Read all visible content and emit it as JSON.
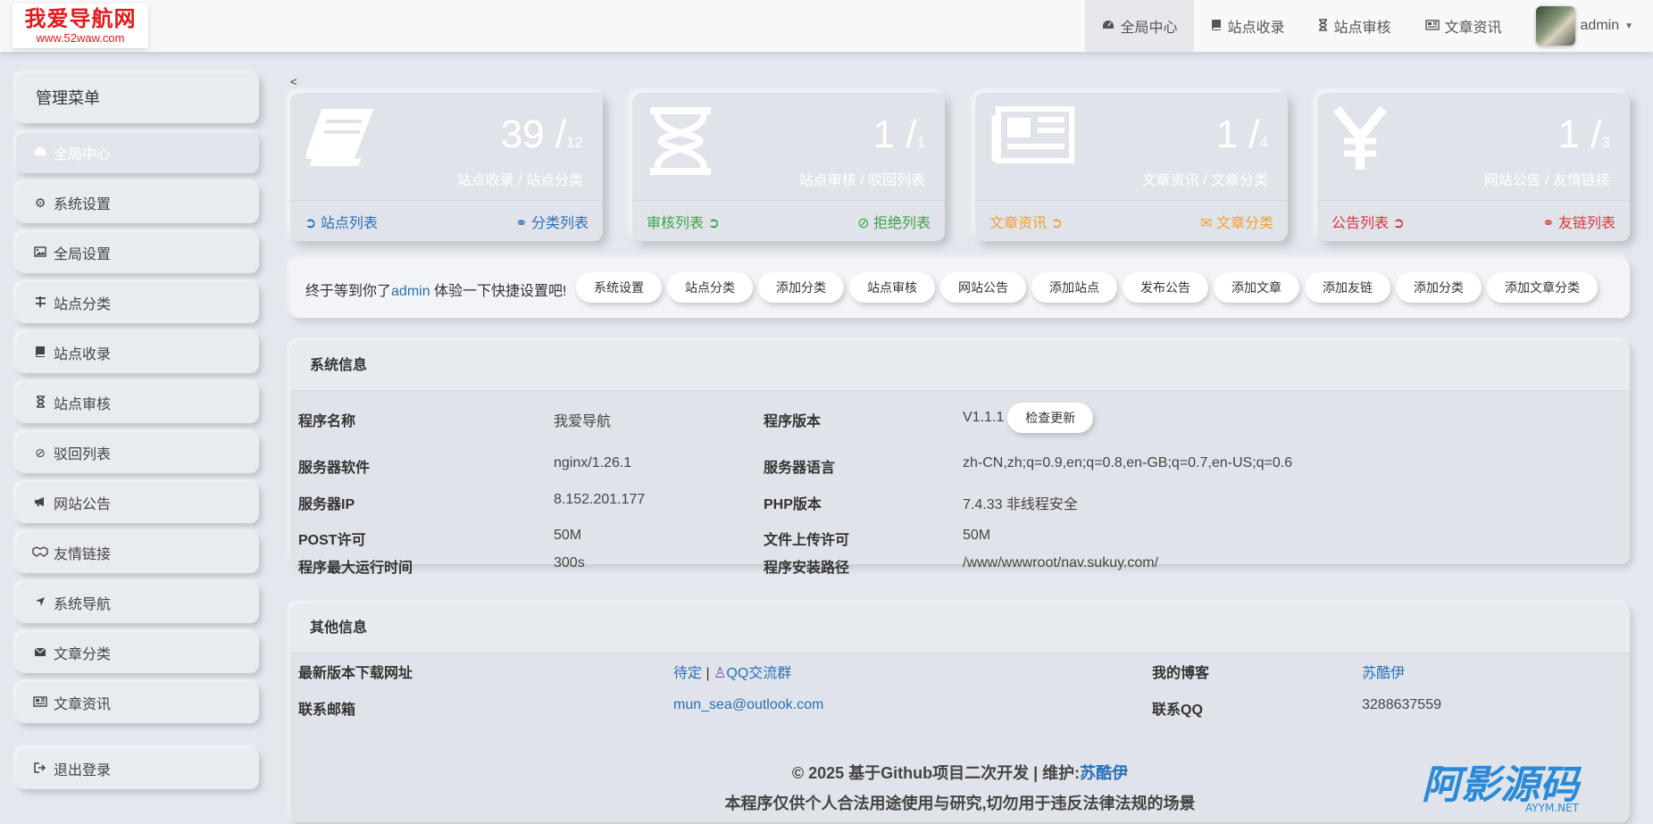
{
  "logo": {
    "title": "我爱导航网",
    "url": "www.52waw.com"
  },
  "topnav": {
    "items": [
      {
        "label": "全局中心",
        "icon": "dashboard-icon"
      },
      {
        "label": "站点收录",
        "icon": "book-icon"
      },
      {
        "label": "站点审核",
        "icon": "hourglass-icon"
      },
      {
        "label": "文章资讯",
        "icon": "newspaper-icon"
      }
    ],
    "user": "admin"
  },
  "sidebar": {
    "title": "管理菜单",
    "items": [
      {
        "label": "全局中心",
        "icon": "dashboard-icon"
      },
      {
        "label": "系统设置",
        "icon": "gear-icon"
      },
      {
        "label": "全局设置",
        "icon": "image-icon"
      },
      {
        "label": "站点分类",
        "icon": "sliders-icon"
      },
      {
        "label": "站点收录",
        "icon": "book-icon"
      },
      {
        "label": "站点审核",
        "icon": "hourglass-icon"
      },
      {
        "label": "驳回列表",
        "icon": "ban-icon"
      },
      {
        "label": "网站公告",
        "icon": "bullhorn-icon"
      },
      {
        "label": "友情链接",
        "icon": "handshake-icon"
      },
      {
        "label": "系统导航",
        "icon": "location-arrow-icon"
      },
      {
        "label": "文章分类",
        "icon": "envelope-icon"
      },
      {
        "label": "文章资讯",
        "icon": "newspaper-icon"
      }
    ],
    "logout": "退出登录"
  },
  "back": "<",
  "cards": [
    {
      "count": "39",
      "sep": " /",
      "sub": "12",
      "caption": "站点收录 / 站点分类",
      "left_link": "站点列表",
      "right_link": "分类列表",
      "color": "#2a6fb7"
    },
    {
      "count": "1",
      "sep": " /",
      "sub": "1",
      "caption": "站点审核 / 驳回列表",
      "left_link": "审核列表",
      "right_link": "拒绝列表",
      "color": "#3aa54a"
    },
    {
      "count": "1",
      "sep": " /",
      "sub": "4",
      "caption": "文章资讯 / 文章分类",
      "left_link": "文章资讯",
      "right_link": "文章分类",
      "color": "#f0a030"
    },
    {
      "count": "1",
      "sep": " /",
      "sub": "3",
      "caption": "网站公告 / 友情链接",
      "left_link": "公告列表",
      "right_link": "友链列表",
      "color": "#d9363a"
    }
  ],
  "quick": {
    "greet_pre": "终于等到你了",
    "user": "admin",
    "greet_post": " 体验一下快捷设置吧!",
    "buttons": [
      "系统设置",
      "站点分类",
      "添加分类",
      "站点审核",
      "网站公告",
      "添加站点",
      "发布公告",
      "添加文章",
      "添加友链",
      "添加分类",
      "添加文章分类"
    ]
  },
  "system": {
    "title": "系统信息",
    "rows": [
      {
        "l1": "程序名称",
        "v1": "我爱导航",
        "l2": "程序版本",
        "v2": "V1.1.1"
      },
      {
        "l1": "服务器软件",
        "v1": "nginx/1.26.1",
        "l2": "服务器语言",
        "v2": "zh-CN,zh;q=0.9,en;q=0.8,en-GB;q=0.7,en-US;q=0.6"
      },
      {
        "l1": "服务器IP",
        "v1": "8.152.201.177",
        "l2": "PHP版本",
        "v2": "7.4.33 非线程安全"
      },
      {
        "l1": "POST许可",
        "v1": "50M",
        "l2": "文件上传许可",
        "v2": "50M"
      },
      {
        "l1": "程序最大运行时间",
        "v1": "300s",
        "l2": "程序安装路径",
        "v2": "/www/wwwroot/nav.sukuy.com/"
      }
    ],
    "check_update": "检查更新"
  },
  "other": {
    "title": "其他信息",
    "download_label": "最新版本下载网址",
    "download_value": "待定",
    "pipe": " | ",
    "qq_group": "QQ交流群",
    "blog_label": "我的博客",
    "blog_value": "苏酷伊",
    "email_label": "联系邮箱",
    "email_value": "mun_sea@outlook.com",
    "qq_label": "联系QQ",
    "qq_value": "3288637559"
  },
  "footer": {
    "line1_pre": "© 2025 基于Github项目二次开发 | 维护:",
    "line1_author": "苏酷伊",
    "line2": "本程序仅供个人合法用途使用与研究,切勿用于违反法律法规的场景"
  },
  "watermark": {
    "text": "阿影源码",
    "sub": "AYYM.NET"
  }
}
